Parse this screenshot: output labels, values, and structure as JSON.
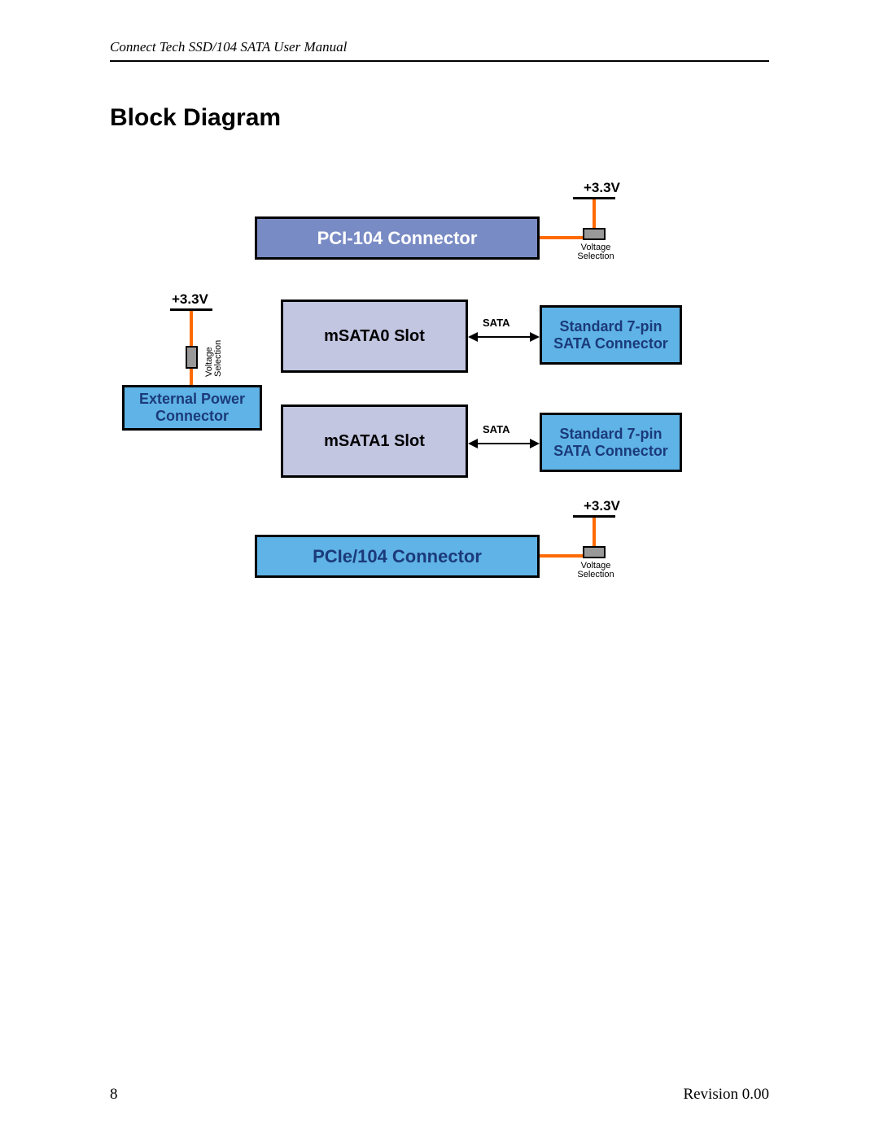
{
  "header": {
    "title": "Connect Tech SSD/104 SATA User Manual"
  },
  "section_title": "Block Diagram",
  "diagram": {
    "voltage_label": "+3.3V",
    "voltage_sel_label": "Voltage\nSelection",
    "pci104": "PCI-104 Connector",
    "pcie104": "PCIe/104 Connector",
    "msata0": "mSATA0 Slot",
    "msata1": "mSATA1 Slot",
    "sata_conn": "Standard 7-pin\nSATA Connector",
    "ext_power": "External Power\nConnector",
    "sata_link_label": "SATA"
  },
  "footer": {
    "page": "8",
    "revision": "Revision 0.00"
  }
}
